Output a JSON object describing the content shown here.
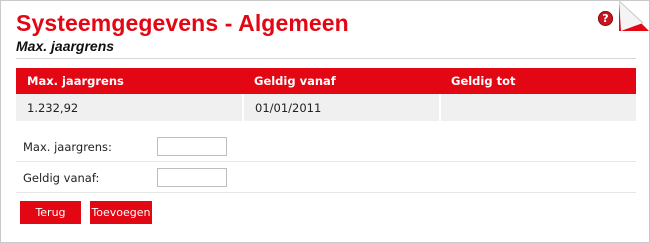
{
  "header": {
    "title": "Systeemgegevens - Algemeen",
    "subtitle": "Max. jaargrens",
    "help_icon": "question-mark-icon",
    "help_glyph": "?"
  },
  "table": {
    "columns": [
      "Max. jaargrens",
      "Geldig vanaf",
      "Geldig tot"
    ],
    "rows": [
      [
        "1.232,92",
        "01/01/2011",
        ""
      ]
    ]
  },
  "form": {
    "max_jaargrens_label": "Max. jaargrens:",
    "max_jaargrens_value": "",
    "geldig_vanaf_label": "Geldig vanaf:",
    "geldig_vanaf_value": ""
  },
  "buttons": {
    "back_label": "Terug",
    "add_label": "Toevoegen"
  },
  "colors": {
    "accent": "#e30613",
    "row_background": "#f0f0f0"
  }
}
